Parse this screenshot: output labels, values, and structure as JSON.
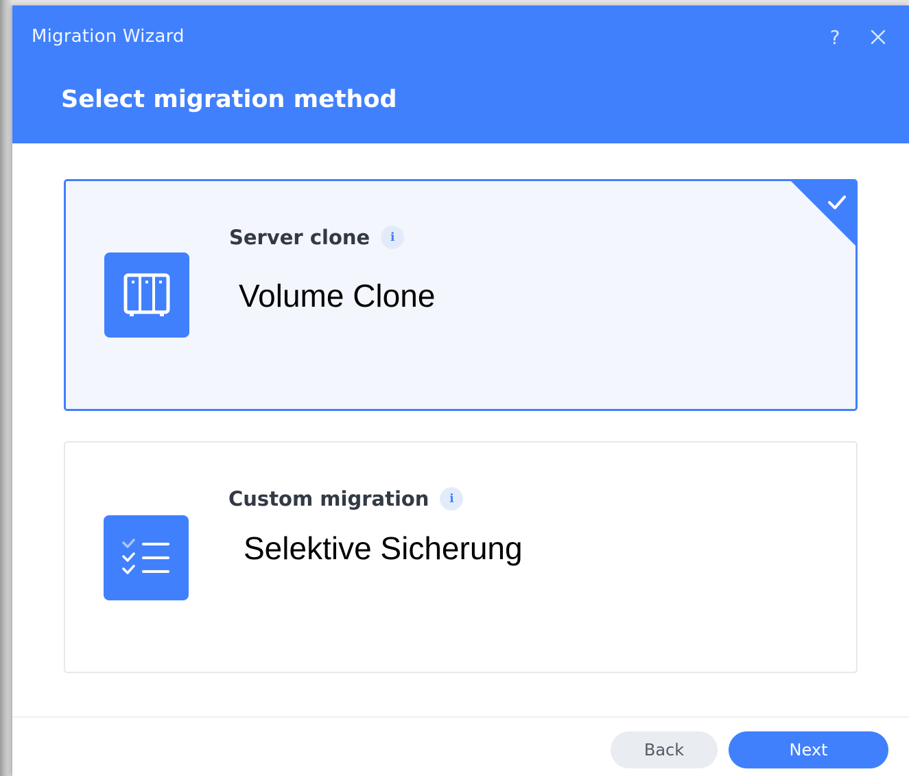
{
  "window": {
    "title": "Migration Wizard",
    "help_icon": "question-mark-icon",
    "help_label": "?",
    "close_icon": "close-icon",
    "close_label": "✕"
  },
  "header": {
    "page_title": "Select migration method"
  },
  "options": [
    {
      "title": "Server clone",
      "description": "Volume Clone",
      "icon": "server-drives-icon",
      "info_icon": "info-icon",
      "info_label": "i",
      "selected": true
    },
    {
      "title": "Custom migration",
      "description": "Selektive Sicherung",
      "icon": "checklist-icon",
      "info_icon": "info-icon",
      "info_label": "i",
      "selected": false
    }
  ],
  "footer": {
    "back_label": "Back",
    "next_label": "Next"
  },
  "colors": {
    "accent": "#4080fd",
    "selected_card_bg": "#f3f6fd",
    "info_bg": "#e3ebfb"
  }
}
